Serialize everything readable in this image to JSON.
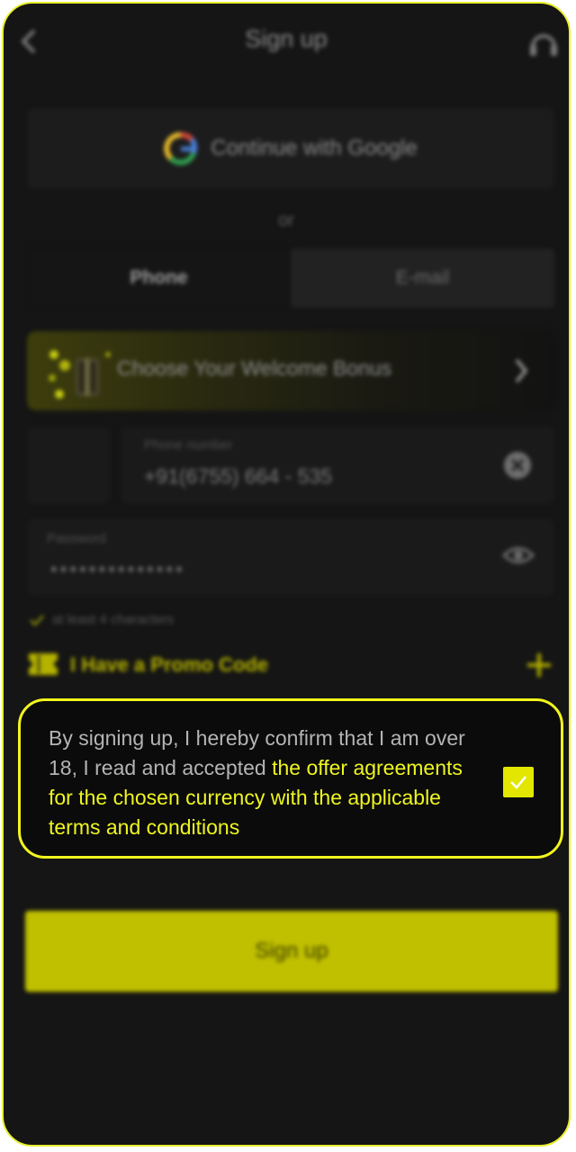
{
  "header": {
    "title": "Sign up"
  },
  "google": {
    "label": "Continue with Google"
  },
  "divider": {
    "text": "or"
  },
  "tabs": [
    {
      "label": "Phone"
    },
    {
      "label": "E-mail"
    }
  ],
  "bonus": {
    "label": "Choose Your Welcome Bonus"
  },
  "phone_field": {
    "label": "Phone number",
    "value": "+91(6755) 664 - 535"
  },
  "password_field": {
    "label": "Password",
    "value": "••••••••••••••"
  },
  "password_hint": {
    "text": "at least 4 characters"
  },
  "promo": {
    "label": "I Have a Promo Code"
  },
  "consent": {
    "text_plain": "By signing up, I hereby confirm that I am over 18, I read and accepted ",
    "text_link": "the offer agreements for the chosen currency with the applicable terms and conditions",
    "checked": true
  },
  "signup_button": {
    "label": "Sign up"
  },
  "colors": {
    "accent": "#eef520",
    "button": "#c0c000",
    "background": "#151515"
  },
  "icons": [
    "back-arrow-icon",
    "support-icon",
    "google-icon",
    "gift-icon",
    "chevron-right-icon",
    "clear-icon",
    "eye-icon",
    "check-icon",
    "ticket-icon",
    "plus-icon",
    "checkbox-check-icon"
  ]
}
